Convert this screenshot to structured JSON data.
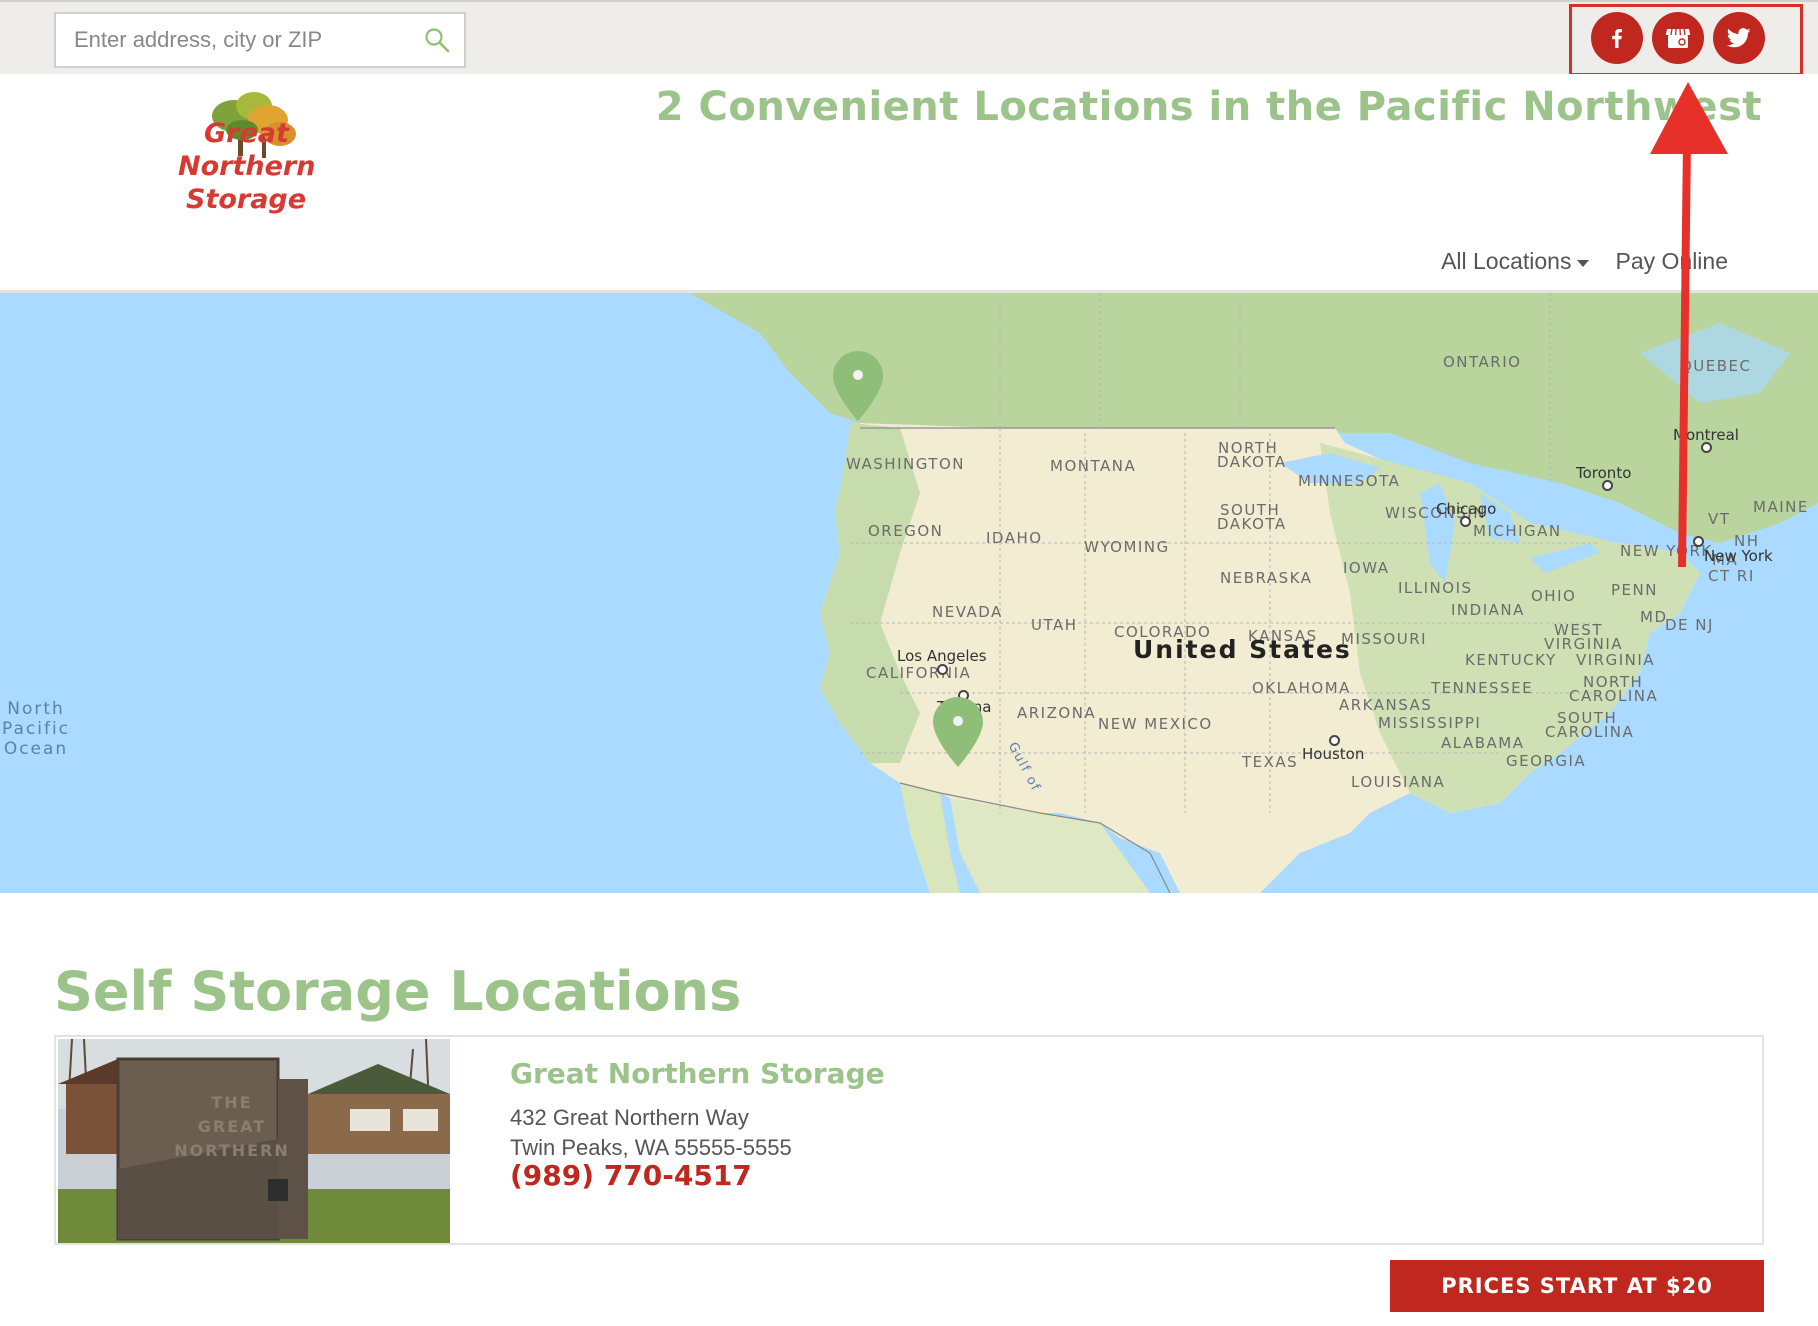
{
  "search": {
    "placeholder": "Enter address, city or ZIP",
    "value": ""
  },
  "social": [
    {
      "name": "facebook",
      "icon": "facebook-icon"
    },
    {
      "name": "google-my-business",
      "icon": "storefront-icon"
    },
    {
      "name": "twitter",
      "icon": "twitter-icon"
    }
  ],
  "logo": {
    "line1": "Great",
    "line2": "Northern",
    "line3": "Storage"
  },
  "header": {
    "tagline": "2 Convenient Locations in the Pacific Northwest"
  },
  "nav": {
    "all_locations": "All Locations",
    "pay_online": "Pay Online"
  },
  "map": {
    "country": "United States",
    "ocean": [
      "North",
      "Pacific",
      "Ocean"
    ],
    "regions": [
      "ONTARIO",
      "QUEBEC",
      "WASHINGTON",
      "MONTANA",
      "NORTH",
      "DAKOTA",
      "MINNESOTA",
      "MONTANA",
      "OREGON",
      "IDAHO",
      "WYOMING",
      "SOUTH",
      "DAKOTA",
      "WISCONSIN",
      "MICHIGAN",
      "NEBRASKA",
      "IOWA",
      "ILLINOIS",
      "OHIO",
      "PENN",
      "NEVADA",
      "UTAH",
      "COLORADO",
      "KANSAS",
      "MISSOURI",
      "INDIANA",
      "WEST",
      "VIRGINIA",
      "CALIFORNIA",
      "KENTUCKY",
      "VIRGINIA",
      "OKLAHOMA",
      "TENNESSEE",
      "NORTH",
      "CAROLINA",
      "ARIZONA",
      "NEW MEXICO",
      "ARKANSAS",
      "MISSISSIPPI",
      "SOUTH",
      "CAROLINA",
      "ALABAMA",
      "GEORGIA",
      "TEXAS",
      "LOUISIANA",
      "NEW YORK",
      "MAINE",
      "VT",
      "NH",
      "MA",
      "CT RI",
      "MD",
      "DE NJ"
    ],
    "cities": [
      "Montreal",
      "Toronto",
      "Chicago",
      "New York",
      "Los Angeles",
      "Tijuana",
      "Houston"
    ],
    "misc": [
      "Gulf of"
    ]
  },
  "section": {
    "title": "Self Storage Locations"
  },
  "locations": [
    {
      "name": "Great Northern Storage",
      "address1": "432 Great Northern Way",
      "address2": "Twin Peaks, WA 55555-5555",
      "phone": "(989) 770-4517",
      "sign_text": [
        "THE",
        "GREAT",
        "NORTHERN"
      ]
    }
  ],
  "cta": {
    "price_label": "PRICES START AT $20"
  },
  "colors": {
    "brand_green": "#9cc48a",
    "brand_red": "#c0281f",
    "annotation_red": "#e8302a"
  }
}
